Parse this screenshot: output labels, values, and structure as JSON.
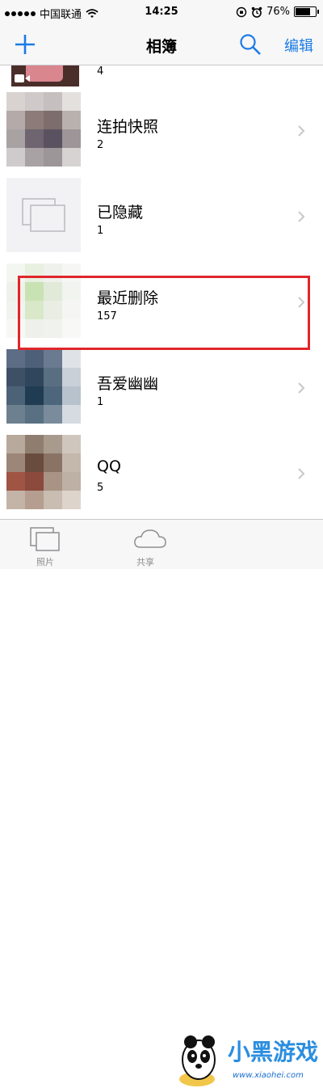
{
  "status_bar": {
    "carrier": "中国联通",
    "time": "14:25",
    "battery": "76%",
    "battery_level": 0.76
  },
  "nav": {
    "title": "相簿",
    "edit_label": "编辑",
    "add_icon": "plus-icon",
    "search_icon": "search-icon"
  },
  "albums": [
    {
      "name": "",
      "count": "4"
    },
    {
      "name": "连拍快照",
      "count": "2"
    },
    {
      "name": "已隐藏",
      "count": "1"
    },
    {
      "name": "最近删除",
      "count": "157"
    },
    {
      "name": "吾爱幽幽",
      "count": "1"
    },
    {
      "name": "QQ",
      "count": "5"
    }
  ],
  "tabs": [
    {
      "label": "照片",
      "icon": "photos-icon"
    },
    {
      "label": "共享",
      "icon": "cloud-icon"
    }
  ],
  "watermark": {
    "brand": "小黑游戏",
    "site": "www.xiaohei.com"
  },
  "colors": {
    "accent": "#1b7be6",
    "highlight": "#e0262b"
  }
}
